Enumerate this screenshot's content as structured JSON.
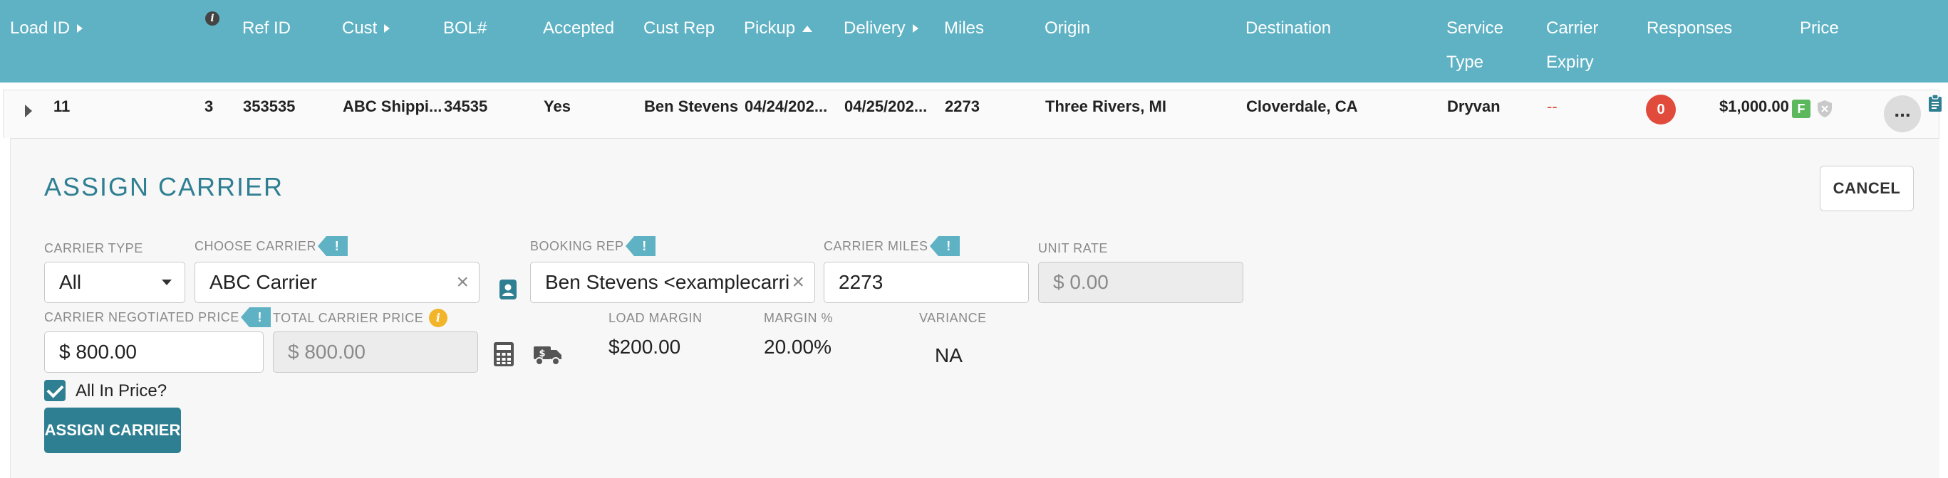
{
  "header": {
    "columns": {
      "load_id": "Load ID",
      "ref_id": "Ref ID",
      "cust": "Cust",
      "bol": "BOL#",
      "accepted": "Accepted",
      "cust_rep": "Cust Rep",
      "pickup": "Pickup",
      "delivery": "Delivery",
      "miles": "Miles",
      "origin": "Origin",
      "destination": "Destination",
      "service_type": "Service Type",
      "carrier_expiry": "Carrier Expiry",
      "responses": "Responses",
      "price": "Price"
    }
  },
  "row": {
    "load_id": "11",
    "info_count": "3",
    "ref_id": "353535",
    "cust": "ABC Shippi...",
    "bol": "34535",
    "accepted": "Yes",
    "cust_rep": "Ben Stevens",
    "pickup": "04/24/202...",
    "delivery": "04/25/202...",
    "miles": "2273",
    "origin": "Three Rivers, MI",
    "destination": "Cloverdale, CA",
    "service_type": "Dryvan",
    "carrier_expiry": "--",
    "responses": "0",
    "price": "$1,000.00",
    "price_badge": "F",
    "more": "..."
  },
  "assign": {
    "title": "ASSIGN CARRIER",
    "cancel_label": "CANCEL",
    "carrier_type_label": "CARRIER TYPE",
    "carrier_type_value": "All",
    "choose_carrier_label": "CHOOSE CARRIER",
    "choose_carrier_value": "ABC Carrier",
    "booking_rep_label": "BOOKING REP",
    "booking_rep_value": "Ben Stevens <examplecarri...",
    "carrier_miles_label": "CARRIER MILES",
    "carrier_miles_value": "2273",
    "unit_rate_label": "UNIT RATE",
    "unit_rate_value": "$ 0.00",
    "negotiated_price_label": "CARRIER NEGOTIATED PRICE",
    "negotiated_price_value": "$ 800.00",
    "total_price_label": "TOTAL CARRIER PRICE",
    "total_price_value": "$ 800.00",
    "load_margin_label": "LOAD MARGIN",
    "load_margin_value": "$200.00",
    "margin_pct_label": "MARGIN %",
    "margin_pct_value": "20.00%",
    "variance_label": "VARIANCE",
    "variance_value": "NA",
    "all_in_price_label": "All In Price?",
    "all_in_price_checked": true,
    "assign_button_label": "ASSIGN CARRIER",
    "flag_glyph": "!"
  },
  "colors": {
    "header_bg": "#5eb2c4",
    "accent": "#2f7f92",
    "badge_red": "#e14b3b",
    "badge_green": "#5cb85c",
    "info_yellow": "#f2b52a",
    "expiry_red": "#e14b3b"
  }
}
